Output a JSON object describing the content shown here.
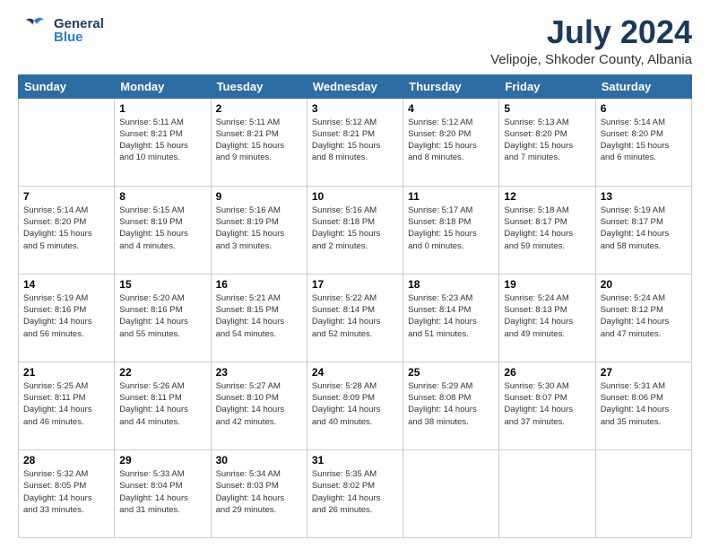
{
  "header": {
    "logo_general": "General",
    "logo_blue": "Blue",
    "month_year": "July 2024",
    "location": "Velipoje, Shkoder County, Albania"
  },
  "weekdays": [
    "Sunday",
    "Monday",
    "Tuesday",
    "Wednesday",
    "Thursday",
    "Friday",
    "Saturday"
  ],
  "weeks": [
    [
      {
        "day": "",
        "info": ""
      },
      {
        "day": "1",
        "info": "Sunrise: 5:11 AM\nSunset: 8:21 PM\nDaylight: 15 hours\nand 10 minutes."
      },
      {
        "day": "2",
        "info": "Sunrise: 5:11 AM\nSunset: 8:21 PM\nDaylight: 15 hours\nand 9 minutes."
      },
      {
        "day": "3",
        "info": "Sunrise: 5:12 AM\nSunset: 8:21 PM\nDaylight: 15 hours\nand 8 minutes."
      },
      {
        "day": "4",
        "info": "Sunrise: 5:12 AM\nSunset: 8:20 PM\nDaylight: 15 hours\nand 8 minutes."
      },
      {
        "day": "5",
        "info": "Sunrise: 5:13 AM\nSunset: 8:20 PM\nDaylight: 15 hours\nand 7 minutes."
      },
      {
        "day": "6",
        "info": "Sunrise: 5:14 AM\nSunset: 8:20 PM\nDaylight: 15 hours\nand 6 minutes."
      }
    ],
    [
      {
        "day": "7",
        "info": "Sunrise: 5:14 AM\nSunset: 8:20 PM\nDaylight: 15 hours\nand 5 minutes."
      },
      {
        "day": "8",
        "info": "Sunrise: 5:15 AM\nSunset: 8:19 PM\nDaylight: 15 hours\nand 4 minutes."
      },
      {
        "day": "9",
        "info": "Sunrise: 5:16 AM\nSunset: 8:19 PM\nDaylight: 15 hours\nand 3 minutes."
      },
      {
        "day": "10",
        "info": "Sunrise: 5:16 AM\nSunset: 8:18 PM\nDaylight: 15 hours\nand 2 minutes."
      },
      {
        "day": "11",
        "info": "Sunrise: 5:17 AM\nSunset: 8:18 PM\nDaylight: 15 hours\nand 0 minutes."
      },
      {
        "day": "12",
        "info": "Sunrise: 5:18 AM\nSunset: 8:17 PM\nDaylight: 14 hours\nand 59 minutes."
      },
      {
        "day": "13",
        "info": "Sunrise: 5:19 AM\nSunset: 8:17 PM\nDaylight: 14 hours\nand 58 minutes."
      }
    ],
    [
      {
        "day": "14",
        "info": "Sunrise: 5:19 AM\nSunset: 8:16 PM\nDaylight: 14 hours\nand 56 minutes."
      },
      {
        "day": "15",
        "info": "Sunrise: 5:20 AM\nSunset: 8:16 PM\nDaylight: 14 hours\nand 55 minutes."
      },
      {
        "day": "16",
        "info": "Sunrise: 5:21 AM\nSunset: 8:15 PM\nDaylight: 14 hours\nand 54 minutes."
      },
      {
        "day": "17",
        "info": "Sunrise: 5:22 AM\nSunset: 8:14 PM\nDaylight: 14 hours\nand 52 minutes."
      },
      {
        "day": "18",
        "info": "Sunrise: 5:23 AM\nSunset: 8:14 PM\nDaylight: 14 hours\nand 51 minutes."
      },
      {
        "day": "19",
        "info": "Sunrise: 5:24 AM\nSunset: 8:13 PM\nDaylight: 14 hours\nand 49 minutes."
      },
      {
        "day": "20",
        "info": "Sunrise: 5:24 AM\nSunset: 8:12 PM\nDaylight: 14 hours\nand 47 minutes."
      }
    ],
    [
      {
        "day": "21",
        "info": "Sunrise: 5:25 AM\nSunset: 8:11 PM\nDaylight: 14 hours\nand 46 minutes."
      },
      {
        "day": "22",
        "info": "Sunrise: 5:26 AM\nSunset: 8:11 PM\nDaylight: 14 hours\nand 44 minutes."
      },
      {
        "day": "23",
        "info": "Sunrise: 5:27 AM\nSunset: 8:10 PM\nDaylight: 14 hours\nand 42 minutes."
      },
      {
        "day": "24",
        "info": "Sunrise: 5:28 AM\nSunset: 8:09 PM\nDaylight: 14 hours\nand 40 minutes."
      },
      {
        "day": "25",
        "info": "Sunrise: 5:29 AM\nSunset: 8:08 PM\nDaylight: 14 hours\nand 38 minutes."
      },
      {
        "day": "26",
        "info": "Sunrise: 5:30 AM\nSunset: 8:07 PM\nDaylight: 14 hours\nand 37 minutes."
      },
      {
        "day": "27",
        "info": "Sunrise: 5:31 AM\nSunset: 8:06 PM\nDaylight: 14 hours\nand 35 minutes."
      }
    ],
    [
      {
        "day": "28",
        "info": "Sunrise: 5:32 AM\nSunset: 8:05 PM\nDaylight: 14 hours\nand 33 minutes."
      },
      {
        "day": "29",
        "info": "Sunrise: 5:33 AM\nSunset: 8:04 PM\nDaylight: 14 hours\nand 31 minutes."
      },
      {
        "day": "30",
        "info": "Sunrise: 5:34 AM\nSunset: 8:03 PM\nDaylight: 14 hours\nand 29 minutes."
      },
      {
        "day": "31",
        "info": "Sunrise: 5:35 AM\nSunset: 8:02 PM\nDaylight: 14 hours\nand 26 minutes."
      },
      {
        "day": "",
        "info": ""
      },
      {
        "day": "",
        "info": ""
      },
      {
        "day": "",
        "info": ""
      }
    ]
  ]
}
